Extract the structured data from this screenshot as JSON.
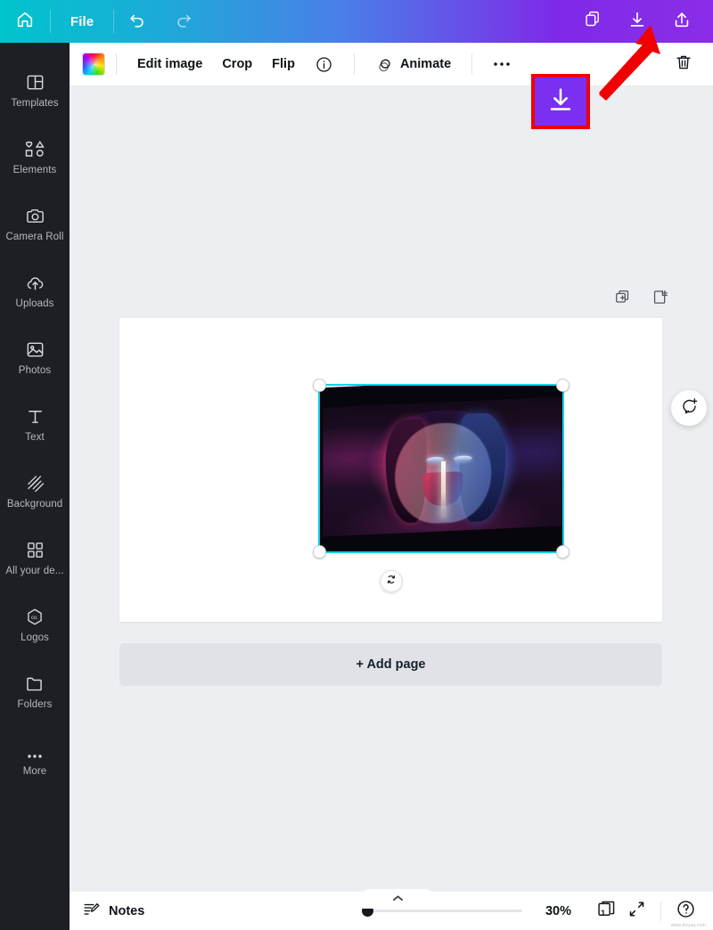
{
  "topbar": {
    "home_icon": "home-icon",
    "file_label": "File",
    "undo_icon": "undo-icon",
    "redo_icon": "redo-icon",
    "copy_icon": "duplicate-icon",
    "download_icon": "download-icon",
    "share_icon": "share-upload-icon",
    "gradient_start": "#00c4cc",
    "gradient_end": "#8b2de8"
  },
  "sidebar": {
    "items": [
      {
        "label": "Templates",
        "icon": "templates-icon"
      },
      {
        "label": "Elements",
        "icon": "elements-icon"
      },
      {
        "label": "Camera Roll",
        "icon": "camera-icon"
      },
      {
        "label": "Uploads",
        "icon": "upload-cloud-icon"
      },
      {
        "label": "Photos",
        "icon": "photo-icon"
      },
      {
        "label": "Text",
        "icon": "text-t-icon"
      },
      {
        "label": "Background",
        "icon": "background-hatch-icon"
      },
      {
        "label": "All your de...",
        "icon": "grid-squares-icon"
      },
      {
        "label": "Logos",
        "icon": "logo-hex-icon"
      },
      {
        "label": "Folders",
        "icon": "folder-icon"
      },
      {
        "label": "More",
        "icon": "more-dots-icon"
      }
    ]
  },
  "toolbar": {
    "swatch_name": "color-swatch",
    "edit_image_label": "Edit image",
    "crop_label": "Crop",
    "flip_label": "Flip",
    "info_icon": "info-icon",
    "animate_label": "Animate",
    "animate_icon": "animate-icon",
    "more_icon": "more-dots-icon",
    "trash_icon": "trash-icon"
  },
  "canvas": {
    "duplicate_page_icon": "duplicate-page-icon",
    "add_page_icon": "add-page-icon",
    "rotate_icon": "rotate-handle-icon",
    "add_page_label": "+ Add page",
    "magic_icon": "add-comment-icon",
    "selection_color": "#11d3e6"
  },
  "annotation": {
    "badge_icon": "download-icon",
    "badge_fill": "#7b2ff0",
    "badge_border": "#f00000",
    "arrow_color": "#f00000"
  },
  "bottombar": {
    "collapse_icon": "chevron-up-icon",
    "notes_icon": "notes-icon",
    "notes_label": "Notes",
    "zoom_value": "30%",
    "page_number": "1",
    "pages_icon": "page-count-icon",
    "fullscreen_icon": "expand-icon",
    "help_icon": "help-icon",
    "watermark": "www.douaq.com"
  }
}
